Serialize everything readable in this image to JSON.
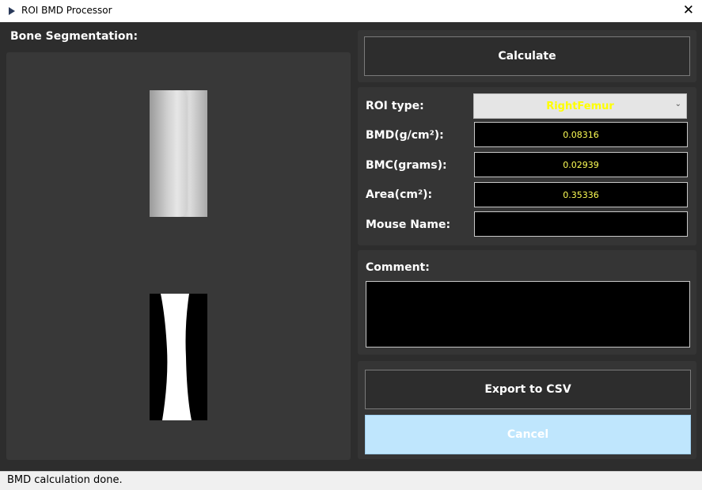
{
  "window": {
    "title": "ROI BMD Processor",
    "close_icon": "close-icon"
  },
  "left": {
    "title": "Bone Segmentation:"
  },
  "calculate_label": "Calculate",
  "fields": {
    "roi_type_label": "ROI type:",
    "roi_type_value": "RightFemur",
    "bmd_label": "BMD(g/cm²):",
    "bmd_value": "0.08316",
    "bmc_label": "BMC(grams):",
    "bmc_value": "0.02939",
    "area_label": "Area(cm²):",
    "area_value": "0.35336",
    "mouse_label": "Mouse Name:",
    "mouse_value": ""
  },
  "comment": {
    "label": "Comment:",
    "value": ""
  },
  "export_label": "Export to CSV",
  "cancel_label": "Cancel",
  "status": "BMD calculation done.",
  "colors": {
    "value_text": "#ffff55",
    "cancel_bg": "#bfe6fd"
  }
}
